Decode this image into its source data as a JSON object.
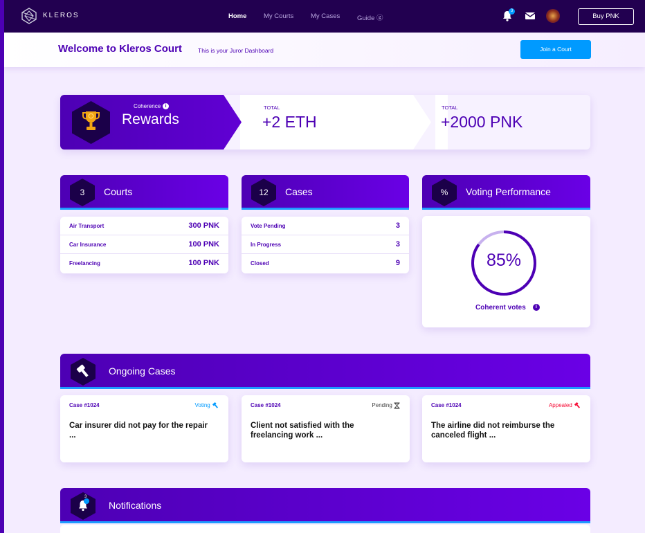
{
  "nav": {
    "logo_text": "KLEROS",
    "links": [
      "Home",
      "My Courts",
      "My Cases",
      "Guide ⓖ"
    ],
    "notification_count": "3",
    "buy_label": "Buy PNK"
  },
  "welcome": {
    "title": "Welcome to Kleros Court",
    "subtitle": "This is your Juror Dashboard",
    "join_label": "Join a Court"
  },
  "rewards": {
    "coherence_label": "Coherence",
    "title": "Rewards",
    "eth_label": "TOTAL",
    "eth_value": "+2 ETH",
    "pnk_label": "TOTAL",
    "pnk_value": "+2000 PNK"
  },
  "courts": {
    "count": "3",
    "title": "Courts",
    "rows": [
      {
        "name": "Air Transport",
        "value": "300 PNK"
      },
      {
        "name": "Car Insurance",
        "value": "100 PNK"
      },
      {
        "name": "Freelancing",
        "value": "100 PNK"
      }
    ]
  },
  "cases": {
    "count": "12",
    "title": "Cases",
    "rows": [
      {
        "name": "Vote Pending",
        "value": "3"
      },
      {
        "name": "In Progress",
        "value": "3"
      },
      {
        "name": "Closed",
        "value": "9"
      }
    ]
  },
  "performance": {
    "symbol": "%",
    "title": "Voting Performance",
    "percent": "85%",
    "percent_value": 0.85,
    "label": "Coherent votes"
  },
  "ongoing": {
    "title": "Ongoing Cases",
    "cards": [
      {
        "id": "Case #1024",
        "status": "Voting",
        "status_color": "#009aff",
        "text": "Car insurer did not pay for the repair ..."
      },
      {
        "id": "Case #1024",
        "status": "Pending",
        "status_color": "#444444",
        "text": "Client not satisfied with the freelancing work ..."
      },
      {
        "id": "Case #1024",
        "status": "Appealed",
        "status_color": "#f60c36",
        "text": "The airline did not reimburse the canceled flight ..."
      }
    ]
  },
  "notifications": {
    "title": "Notifications",
    "count": "3"
  },
  "colors": {
    "primary": "#4d00b4",
    "accent": "#009aff",
    "danger": "#f60c36",
    "navbar": "#220050"
  }
}
